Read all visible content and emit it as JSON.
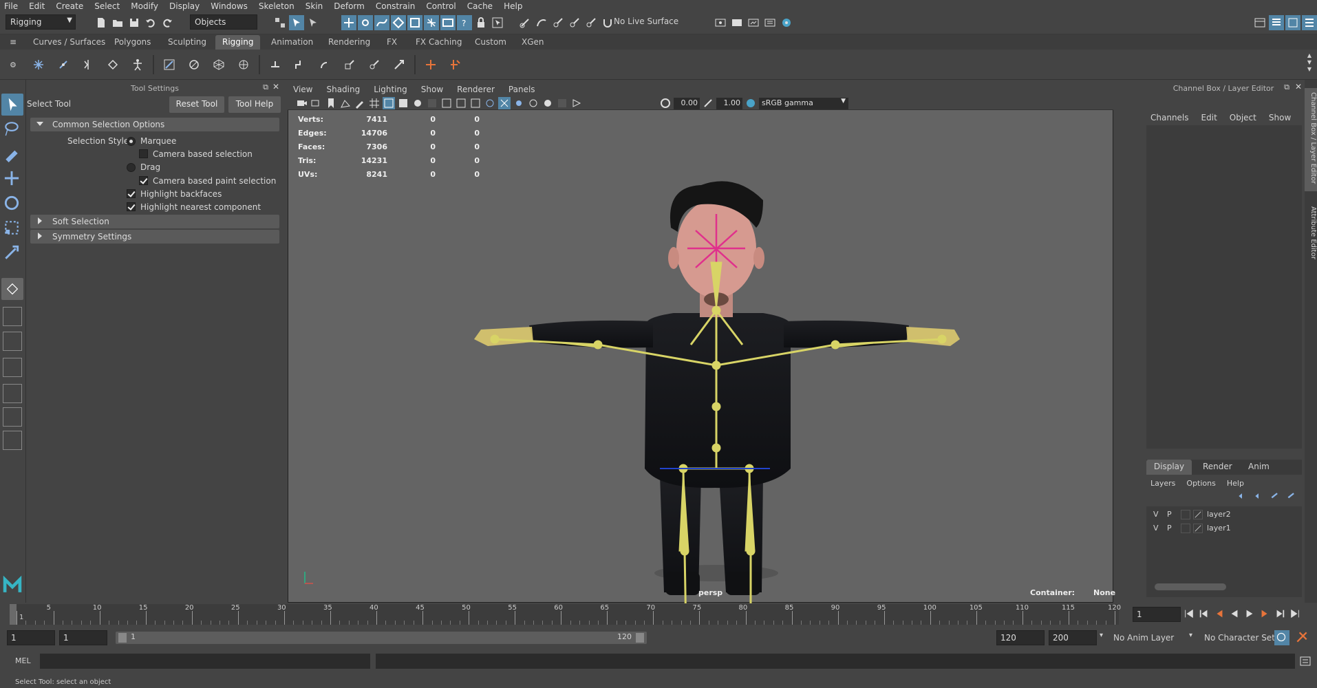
{
  "menu": [
    "File",
    "Edit",
    "Create",
    "Select",
    "Modify",
    "Display",
    "Windows",
    "Skeleton",
    "Skin",
    "Deform",
    "Constrain",
    "Control",
    "Cache",
    "Help"
  ],
  "status": {
    "menuset": "Rigging",
    "selection_mode": "Objects",
    "live_surface": "No Live Surface"
  },
  "shelf_tabs": [
    "Curves / Surfaces",
    "Polygons",
    "Sculpting",
    "Rigging",
    "Animation",
    "Rendering",
    "FX",
    "FX Caching",
    "Custom",
    "XGen"
  ],
  "tool_settings": {
    "panel_title": "Tool Settings",
    "tool_name": "Select Tool",
    "reset_label": "Reset Tool",
    "help_label": "Tool Help",
    "section_common": "Common Selection Options",
    "selection_style_label": "Selection Style:",
    "marquee": "Marquee",
    "camera_based": "Camera based selection",
    "drag": "Drag",
    "camera_paint": "Camera based paint selection",
    "highlight_backfaces": "Highlight backfaces",
    "highlight_nearest": "Highlight nearest component",
    "section_soft": "Soft Selection",
    "section_symmetry": "Symmetry Settings"
  },
  "viewport": {
    "menus": [
      "View",
      "Shading",
      "Lighting",
      "Show",
      "Renderer",
      "Panels"
    ],
    "near_value": "0.00",
    "far_value": "1.00",
    "color_space": "sRGB gamma",
    "camera": "persp",
    "container_label": "Container:",
    "container_value": "None",
    "hud": [
      {
        "label": "Verts:",
        "v1": "7411",
        "v2": "0",
        "v3": "0"
      },
      {
        "label": "Edges:",
        "v1": "14706",
        "v2": "0",
        "v3": "0"
      },
      {
        "label": "Faces:",
        "v1": "7306",
        "v2": "0",
        "v3": "0"
      },
      {
        "label": "Tris:",
        "v1": "14231",
        "v2": "0",
        "v3": "0"
      },
      {
        "label": "UVs:",
        "v1": "8241",
        "v2": "0",
        "v3": "0"
      }
    ]
  },
  "channel_box": {
    "title": "Channel Box / Layer Editor",
    "menus": [
      "Channels",
      "Edit",
      "Object",
      "Show"
    ],
    "layer_tabs": [
      "Display",
      "Render",
      "Anim"
    ],
    "layer_menus": [
      "Layers",
      "Options",
      "Help"
    ],
    "layers": [
      {
        "v": "V",
        "p": "P",
        "name": "layer2"
      },
      {
        "v": "V",
        "p": "P",
        "name": "layer1"
      }
    ],
    "side_tab_1": "Channel Box / Layer Editor",
    "side_tab_2": "Attribute Editor"
  },
  "timeline": {
    "ticks": [
      "1",
      "5",
      "10",
      "15",
      "20",
      "25",
      "30",
      "35",
      "40",
      "45",
      "50",
      "55",
      "60",
      "65",
      "70",
      "75",
      "80",
      "85",
      "90",
      "95",
      "100",
      "105",
      "110",
      "115",
      "120"
    ],
    "current_frame": "1"
  },
  "range": {
    "start": "1",
    "playback_start": "1",
    "slider_start": "1",
    "slider_end": "120",
    "playback_end": "120",
    "end": "200",
    "anim_layer": "No Anim Layer",
    "character_set": "No Character Set"
  },
  "mel": {
    "label": "MEL"
  },
  "help_line": "Select Tool: select an object",
  "colors": {
    "accent_blue": "#5285a6",
    "joint_yellow": "#d8d466",
    "bg": "#444444",
    "viewport_bg": "#646464"
  }
}
